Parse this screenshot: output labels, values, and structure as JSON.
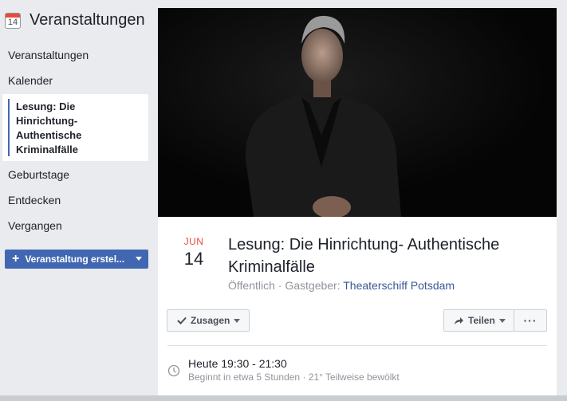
{
  "sidebar": {
    "title": "Veranstaltungen",
    "calendar_icon_number": "14",
    "items": [
      {
        "label": "Veranstaltungen"
      },
      {
        "label": "Kalender"
      },
      {
        "label": "Lesung: Die Hinrichtung- Authentische Kriminalfälle",
        "active": true
      },
      {
        "label": "Geburtstage"
      },
      {
        "label": "Entdecken"
      },
      {
        "label": "Vergangen"
      }
    ],
    "create_button": "Veranstaltung erstel..."
  },
  "event": {
    "month": "JUN",
    "day": "14",
    "title": "Lesung: Die Hinrichtung- Authentische Kriminalfälle",
    "visibility": "Öffentlich",
    "separator": " · ",
    "host_label": "Gastgeber:",
    "host": "Theaterschiff Potsdam",
    "actions": {
      "going": "Zusagen",
      "share": "Teilen",
      "more": "···"
    },
    "time": {
      "main": "Heute 19:30 - 21:30",
      "sub": "Beginnt in etwa 5 Stunden · 21° Teilweise bewölkt"
    }
  },
  "colors": {
    "accent": "#4267b2",
    "date_red": "#e8493f",
    "link": "#385898"
  }
}
